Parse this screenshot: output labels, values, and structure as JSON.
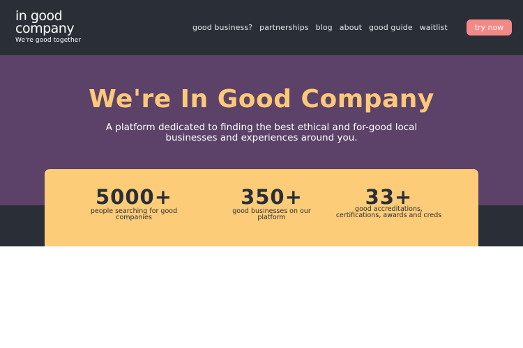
{
  "brand": {
    "line1": "in good",
    "line2": "company",
    "tagline": "We're good together"
  },
  "nav": {
    "items": [
      "good business?",
      "partnerships",
      "blog",
      "about",
      "good guide",
      "waitlist"
    ],
    "cta_label": "try now"
  },
  "hero": {
    "title": "We're In Good Company",
    "subtitle": "A platform dedicated to finding the best ethical and for-good local businesses and experiences around you."
  },
  "stats": [
    {
      "value": "5000+",
      "label": "people searching for good companies"
    },
    {
      "value": "350+",
      "label": "good businesses on our platform"
    },
    {
      "value": "33+",
      "label": "good accreditations, certifications, awards and creds"
    }
  ],
  "colors": {
    "header_bg": "#2a2f37",
    "hero_bg": "#5c4168",
    "accent_yellow": "#fdcc78",
    "cta_pink": "#f38987"
  }
}
